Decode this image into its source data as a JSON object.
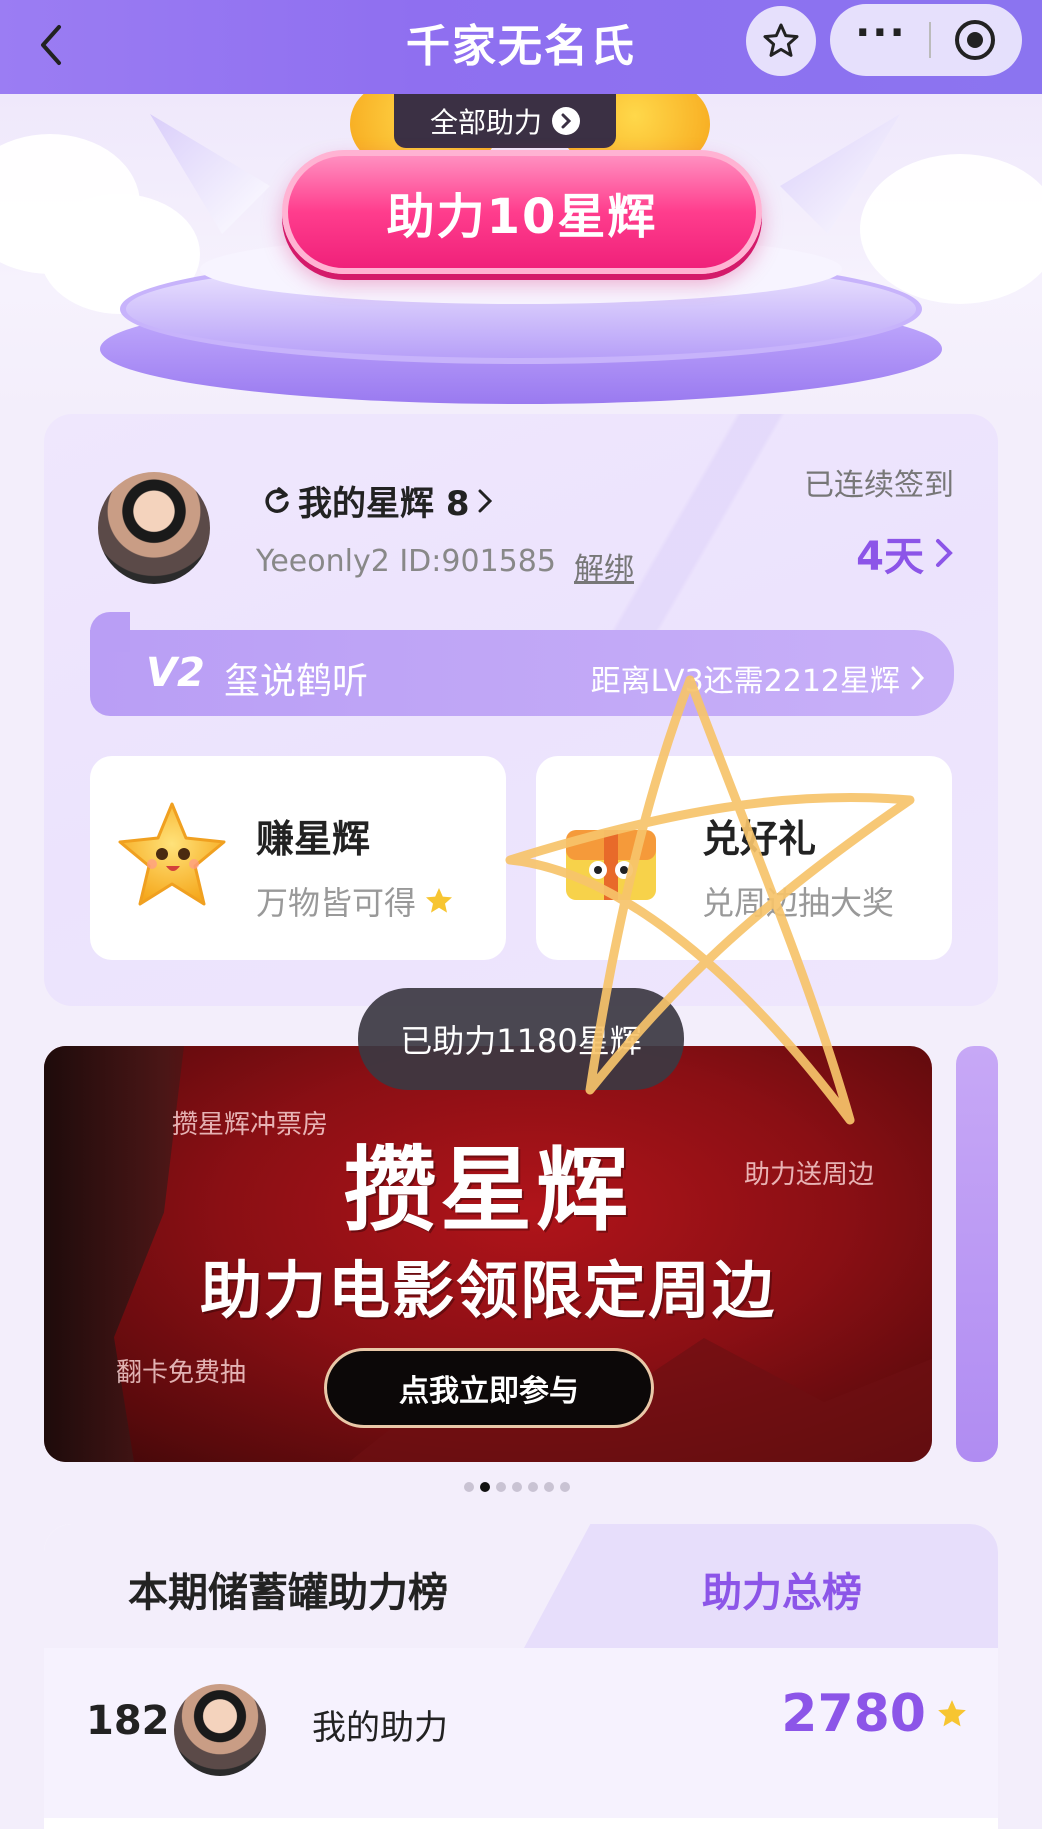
{
  "nav": {
    "title": "千家无名氏",
    "more_label": "···"
  },
  "hero": {
    "all_help_label": "全部助力",
    "help_button_label": "助力10星辉"
  },
  "user": {
    "stars_label": "我的星辉 8",
    "username_id": "Yeeonly2 ID:901585",
    "unbind_label": "解绑",
    "checkin_label": "已连续签到",
    "checkin_days": "4天",
    "level_badge": "V2",
    "level_name": "玺说鹤听",
    "level_progress": "距离LV3还需2212星辉"
  },
  "features": {
    "earn_title": "赚星辉",
    "earn_sub": "万物皆可得",
    "redeem_title": "兑好礼",
    "redeem_sub": "兑周边抽大奖"
  },
  "toast": {
    "text": "已助力1180星辉"
  },
  "banner": {
    "corner_tl": "攒星辉冲票房",
    "corner_tr": "助力送周边",
    "corner_bl": "翻卡免费抽",
    "headline": "攒星辉",
    "subheadline": "助力电影领限定周边",
    "cta_label": "点我立即参与",
    "page_count": 7,
    "active_index": 1
  },
  "ranking": {
    "tab_this_period": "本期储蓄罐助力榜",
    "tab_total": "助力总榜",
    "my_rank": "182",
    "my_label": "我的助力",
    "my_score": "2780"
  },
  "colors": {
    "accent_purple": "#8c55e8",
    "nav_purple": "#9b7df3",
    "help_pink": "#ff3d8d",
    "star_gold": "#f7c531"
  }
}
